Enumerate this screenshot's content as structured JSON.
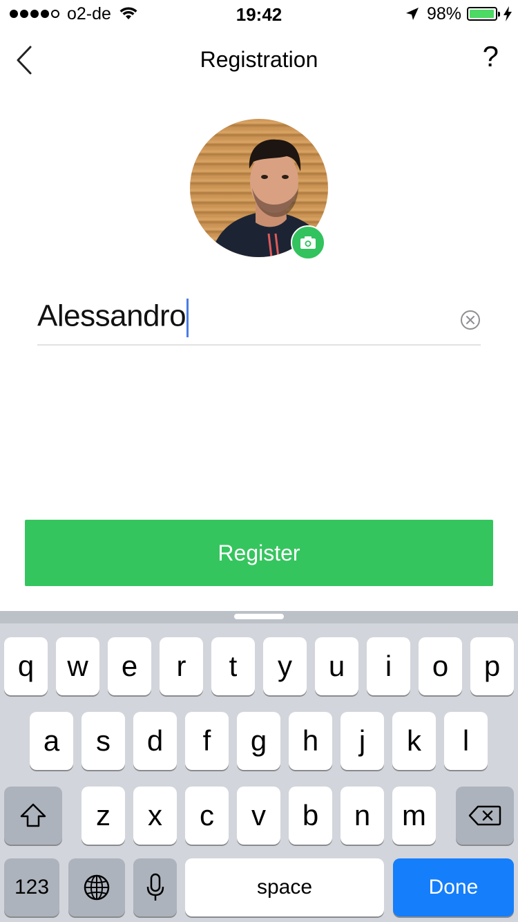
{
  "status_bar": {
    "carrier": "o2-de",
    "time": "19:42",
    "battery": "98%",
    "battery_level": 0.98,
    "battery_color": "#4cd964"
  },
  "nav": {
    "title": "Registration",
    "help_label": "?",
    "back_icon": "chevron-left-icon"
  },
  "profile": {
    "avatar_icon": "avatar-photo",
    "camera_icon": "camera-icon",
    "badge_color": "#32c25e"
  },
  "name_field": {
    "value": "Alessandro",
    "clear_icon": "clear-circle-icon"
  },
  "register_button": {
    "label": "Register",
    "color": "#35c55e"
  },
  "keyboard": {
    "row1": [
      "q",
      "w",
      "e",
      "r",
      "t",
      "y",
      "u",
      "i",
      "o",
      "p"
    ],
    "row2": [
      "a",
      "s",
      "d",
      "f",
      "g",
      "h",
      "j",
      "k",
      "l"
    ],
    "row3": [
      "z",
      "x",
      "c",
      "v",
      "b",
      "n",
      "m"
    ],
    "numbers_label": "123",
    "space_label": "space",
    "done_label": "Done",
    "done_color": "#157efb"
  }
}
